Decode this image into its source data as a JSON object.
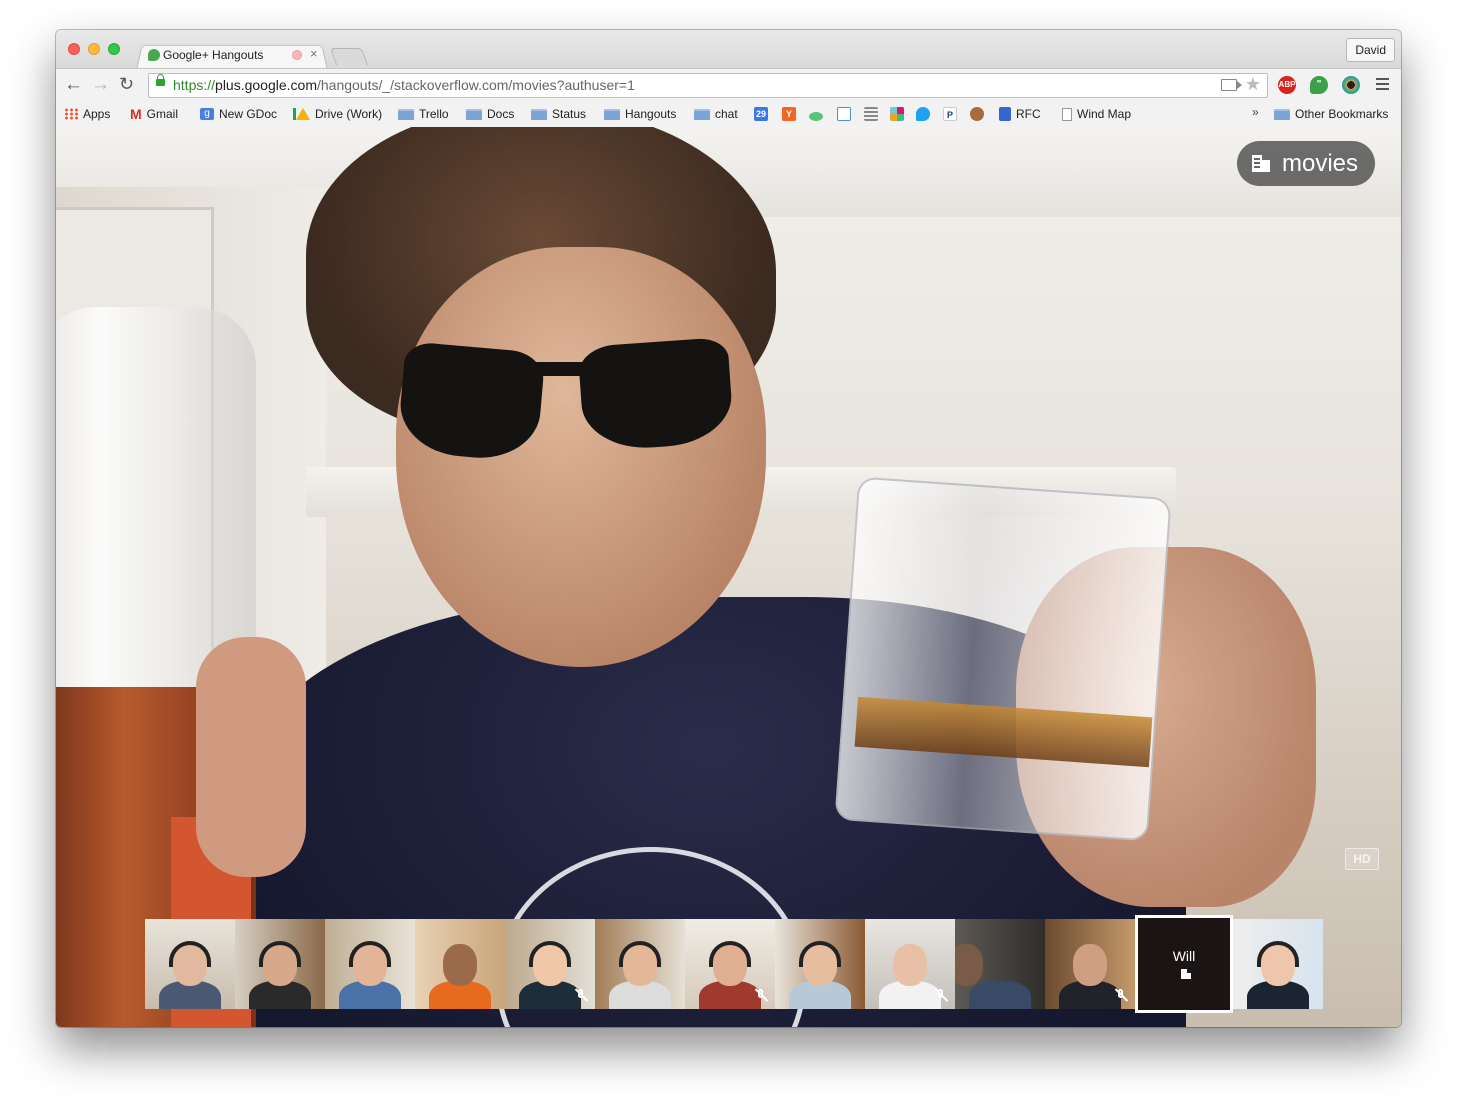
{
  "window": {
    "tab": {
      "title": "Google+ Hangouts",
      "close_glyph": "×",
      "favicon": "hangouts-icon"
    },
    "profile_button": "David"
  },
  "toolbar": {
    "back_glyph": "←",
    "forward_glyph": "→",
    "reload_glyph": "↻",
    "url_scheme": "https://",
    "url_host": "plus.google.com",
    "url_path": "/hangouts/_/stackoverflow.com/movies?authuser=1",
    "star_glyph": "★",
    "extensions": [
      {
        "name": "adblock-plus",
        "label": "ABP",
        "color": "#d8241c"
      },
      {
        "name": "hangouts",
        "label": "\"",
        "color": "#3aa14a"
      },
      {
        "name": "color-picker",
        "label": "",
        "color": "#2a8"
      }
    ]
  },
  "bookmarks": {
    "items": [
      {
        "label": "Apps",
        "icon": "apps-grid-icon"
      },
      {
        "label": "Gmail",
        "icon": "gmail-icon"
      },
      {
        "label": "New GDoc",
        "icon": "google-icon"
      },
      {
        "label": "Drive (Work)",
        "icon": "drive-icon"
      },
      {
        "label": "Trello",
        "icon": "folder-icon"
      },
      {
        "label": "Docs",
        "icon": "folder-icon"
      },
      {
        "label": "Status",
        "icon": "folder-icon"
      },
      {
        "label": "Hangouts",
        "icon": "folder-icon"
      },
      {
        "label": "chat",
        "icon": "folder-icon"
      },
      {
        "label": "RFC",
        "icon": "bookmark-icon"
      },
      {
        "label": "Wind Map",
        "icon": "page-icon"
      }
    ],
    "calendar_day": "29",
    "ycombinator_letter": "Y",
    "pocket_letter": "P",
    "more_glyph": "»",
    "other": "Other Bookmarks"
  },
  "hangout": {
    "room_name": "movies",
    "hd_label": "HD",
    "selected_participant": "Will",
    "participants_count_visible": 13
  },
  "colors": {
    "accent_green": "#2c8a2c",
    "badge_bg": "#464646",
    "selected_thumb_border": "#ffffff"
  }
}
